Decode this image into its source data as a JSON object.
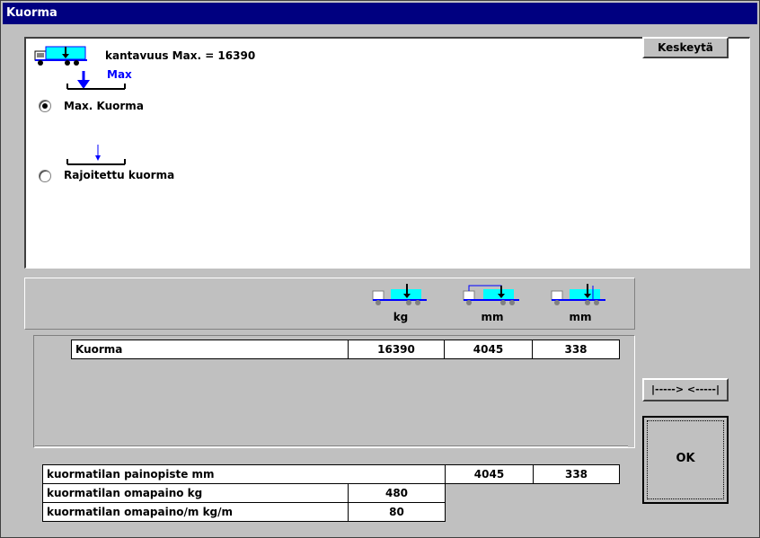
{
  "window": {
    "title": "Kuorma"
  },
  "header": {
    "capacity_text": "kantavuus Max.  =  16390",
    "max_label": "Max"
  },
  "options": [
    {
      "label": "Max. Kuorma",
      "selected": true
    },
    {
      "label": "Rajoitettu kuorma",
      "selected": false
    }
  ],
  "buttons": {
    "cancel": "Keskeytä",
    "range": "|-----> <-----|",
    "ok": "OK"
  },
  "columns": {
    "units": [
      "kg",
      "mm",
      "mm"
    ]
  },
  "load_row": {
    "label": "Kuorma",
    "kg": "16390",
    "mm1": "4045",
    "mm2": "338"
  },
  "cargo_info": {
    "center_of_gravity_label": "kuormatilan painopiste   mm",
    "center_of_gravity_mm1": "4045",
    "center_of_gravity_mm2": "338",
    "own_weight_label": "kuormatilan omapaino   kg",
    "own_weight_value": "480",
    "own_weight_per_m_label": "kuormatilan omapaino/m     kg/m",
    "own_weight_per_m_value": "80"
  },
  "colors": {
    "title_bar": "#000080",
    "accent_blue": "#0000ff",
    "cargo_cyan": "#00ffff"
  }
}
